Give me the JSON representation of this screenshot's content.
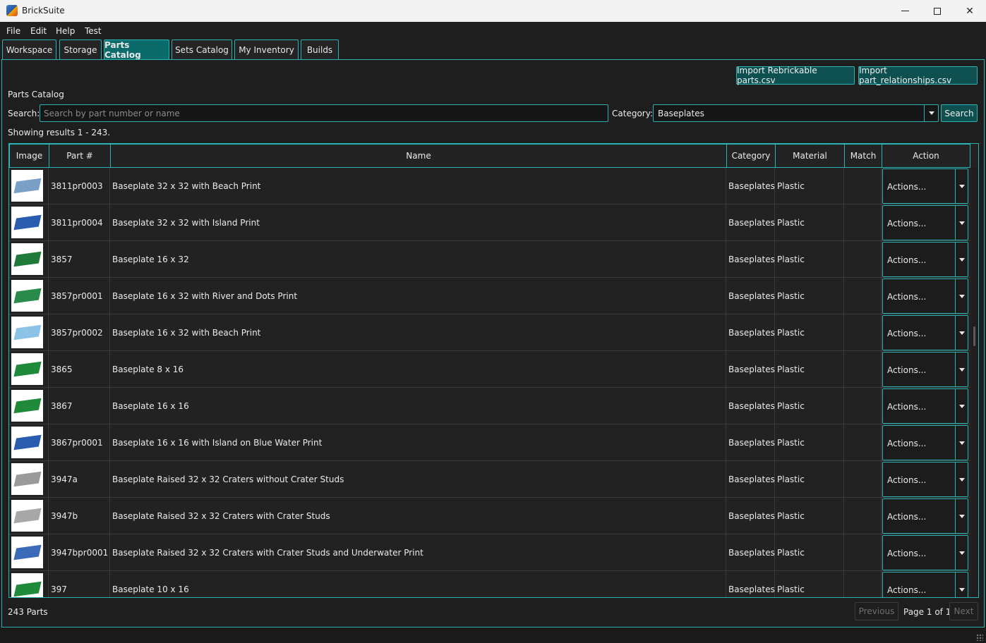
{
  "window": {
    "title": "BrickSuite"
  },
  "menu": [
    "File",
    "Edit",
    "Help",
    "Test"
  ],
  "tabs": [
    "Workspace",
    "Storage",
    "Parts Catalog",
    "Sets Catalog",
    "My Inventory",
    "Builds"
  ],
  "active_tab": "Parts Catalog",
  "toolbar": {
    "import_parts_label": "Import Rebrickable parts.csv",
    "import_relationships_label": "Import part_relationships.csv"
  },
  "section_title": "Parts Catalog",
  "search": {
    "label": "Search:",
    "placeholder": "Search by part number or name",
    "value": "",
    "button_label": "Search"
  },
  "category": {
    "label": "Category:",
    "value": "Baseplates"
  },
  "results_text": "Showing results 1 - 243.",
  "table": {
    "columns": [
      "Image",
      "Part #",
      "Name",
      "Category",
      "Material",
      "Match",
      "Action"
    ],
    "action_label": "Actions...",
    "rows": [
      {
        "part": "3811pr0003",
        "name": "Baseplate 32 x 32 with Beach Print",
        "category": "Baseplates",
        "material": "Plastic",
        "match": "",
        "color": "#7aa0c8"
      },
      {
        "part": "3811pr0004",
        "name": "Baseplate 32 x 32 with Island Print",
        "category": "Baseplates",
        "material": "Plastic",
        "match": "",
        "color": "#2a5db0"
      },
      {
        "part": "3857",
        "name": "Baseplate 16 x 32",
        "category": "Baseplates",
        "material": "Plastic",
        "match": "",
        "color": "#1f7a3a"
      },
      {
        "part": "3857pr0001",
        "name": "Baseplate 16 x 32 with River and Dots Print",
        "category": "Baseplates",
        "material": "Plastic",
        "match": "",
        "color": "#2a8a4a"
      },
      {
        "part": "3857pr0002",
        "name": "Baseplate 16 x 32 with Beach Print",
        "category": "Baseplates",
        "material": "Plastic",
        "match": "",
        "color": "#8cc4e8"
      },
      {
        "part": "3865",
        "name": "Baseplate 8 x 16",
        "category": "Baseplates",
        "material": "Plastic",
        "match": "",
        "color": "#1f8a3a"
      },
      {
        "part": "3867",
        "name": "Baseplate 16 x 16",
        "category": "Baseplates",
        "material": "Plastic",
        "match": "",
        "color": "#1f8a3a"
      },
      {
        "part": "3867pr0001",
        "name": "Baseplate 16 x 16 with Island on Blue Water Print",
        "category": "Baseplates",
        "material": "Plastic",
        "match": "",
        "color": "#2a5db0"
      },
      {
        "part": "3947a",
        "name": "Baseplate Raised 32 x 32 Craters without Crater Studs",
        "category": "Baseplates",
        "material": "Plastic",
        "match": "",
        "color": "#9a9a9a"
      },
      {
        "part": "3947b",
        "name": "Baseplate Raised 32 x 32 Craters with Crater Studs",
        "category": "Baseplates",
        "material": "Plastic",
        "match": "",
        "color": "#a8a8a8"
      },
      {
        "part": "3947bpr0001",
        "name": "Baseplate Raised 32 x 32 Craters with Crater Studs and Underwater Print",
        "category": "Baseplates",
        "material": "Plastic",
        "match": "",
        "color": "#3a6ab8"
      },
      {
        "part": "397",
        "name": "Baseplate 10 x 16",
        "category": "Baseplates",
        "material": "Plastic",
        "match": "",
        "color": "#1f8a3a"
      }
    ]
  },
  "footer": {
    "count_text": "243 Parts",
    "previous_label": "Previous",
    "page_text": "Page 1 of 1",
    "next_label": "Next"
  }
}
